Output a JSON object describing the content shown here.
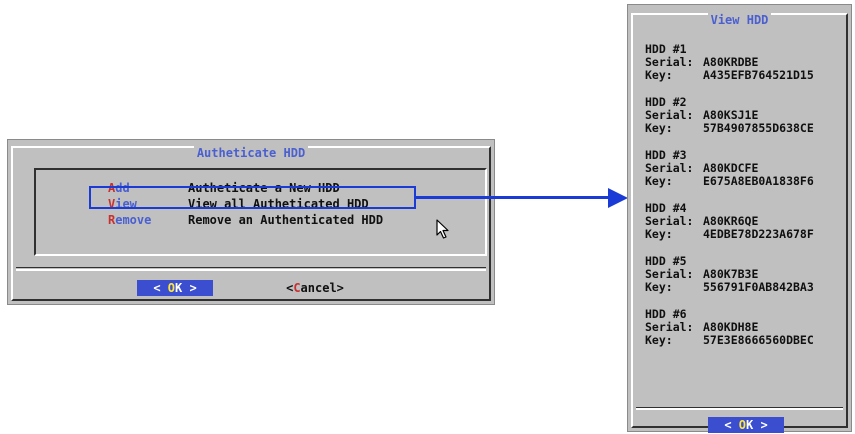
{
  "left_dialog": {
    "title": "Autheticate HDD",
    "menu": [
      {
        "hot": "A",
        "rest": "dd",
        "description": "Autheticate a New HDD"
      },
      {
        "hot": "V",
        "rest": "iew",
        "description": "View all Autheticated HDD"
      },
      {
        "hot": "R",
        "rest": "emove",
        "description": "Remove an Authenticated HDD"
      }
    ],
    "ok_button": {
      "left": "< ",
      "hot": "O",
      "rest": "K",
      "right": " >"
    },
    "cancel_button": {
      "left": "<",
      "hot": "C",
      "rest": "ancel",
      "right": ">"
    }
  },
  "right_dialog": {
    "title": "View HDD",
    "serial_label": "Serial:",
    "key_label": "Key:",
    "hdds": [
      {
        "name": "HDD #1",
        "serial": "A80KRDBE",
        "key": "A435EFB764521D15"
      },
      {
        "name": "HDD #2",
        "serial": "A80KSJ1E",
        "key": "57B4907855D638CE"
      },
      {
        "name": "HDD #3",
        "serial": "A80KDCFE",
        "key": "E675A8EB0A1838F6"
      },
      {
        "name": "HDD #4",
        "serial": "A80KR6QE",
        "key": "4EDBE78D223A678F"
      },
      {
        "name": "HDD #5",
        "serial": "A80K7B3E",
        "key": "556791F0AB842BA3"
      },
      {
        "name": "HDD #6",
        "serial": "A80KDH8E",
        "key": "57E3E8666560DBEC"
      }
    ],
    "ok_button": {
      "left": "< ",
      "hot": "O",
      "rest": "K",
      "right": " >"
    }
  },
  "colors": {
    "dialog_bg": "#c0c0c0",
    "title_blue": "#4a5fd0",
    "hotkey_red": "#c83030",
    "button_blue": "#3a4ecf",
    "hotkey_yellow": "#ffe63a",
    "annotation_blue": "#1a3bd6"
  }
}
